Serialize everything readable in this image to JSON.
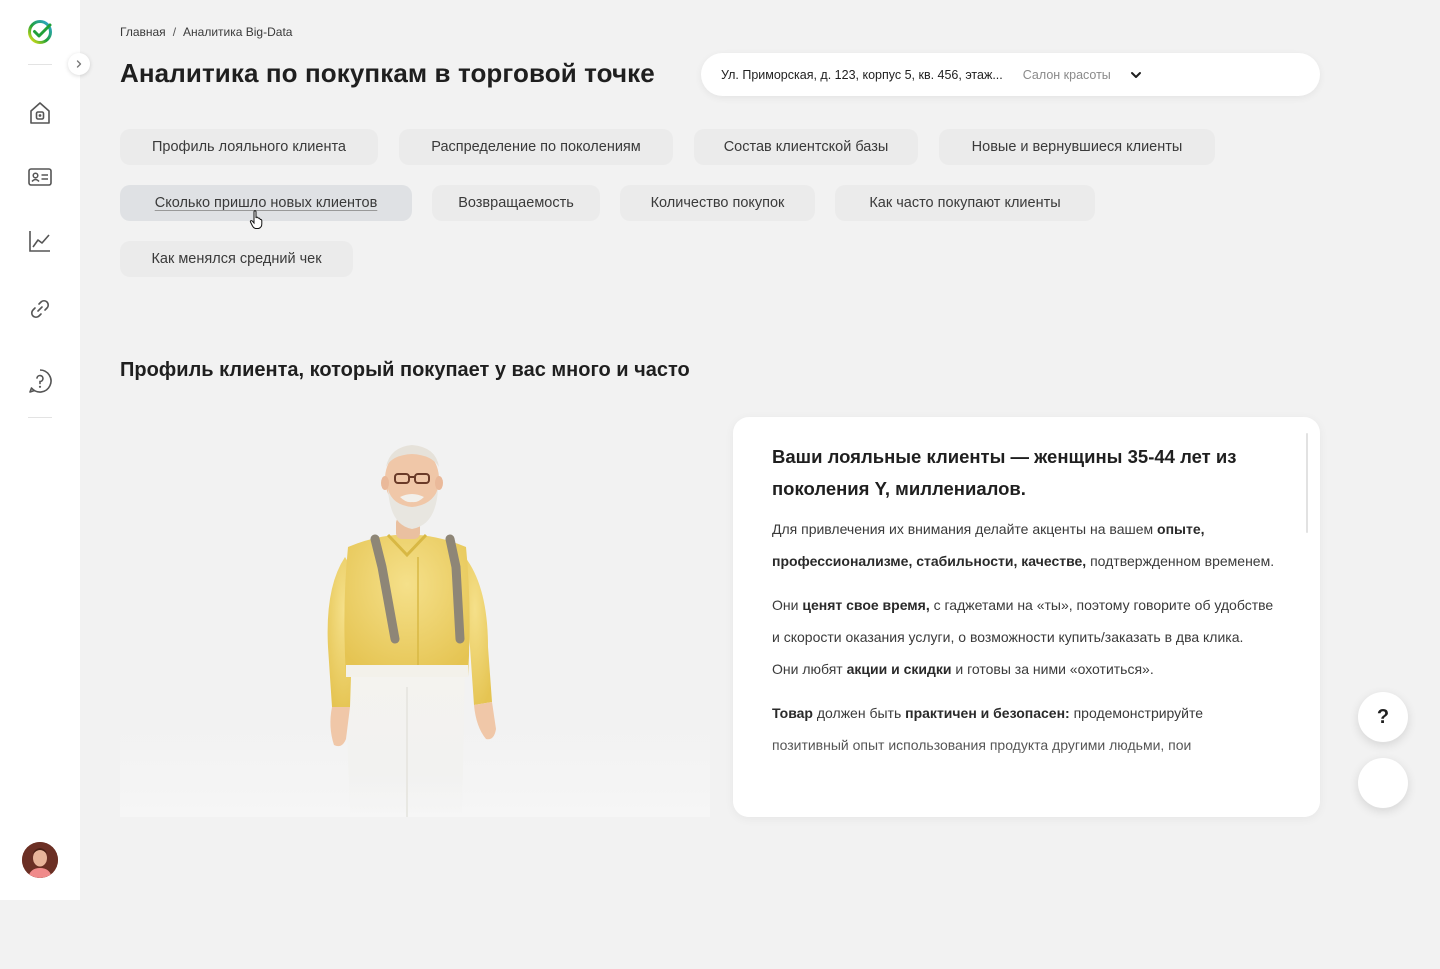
{
  "breadcrumb": {
    "home": "Главная",
    "separator": "/",
    "current": "Аналитика Big-Data"
  },
  "page": {
    "title": "Аналитика по покупкам в торговой точке"
  },
  "location_select": {
    "address": "Ул. Приморская, д. 123, корпус 5, кв. 456, этаж...",
    "category": "Салон красоты"
  },
  "tabs": [
    "Профиль лояльного клиента",
    "Распределение по поколениям",
    "Состав клиентской базы",
    "Новые и вернувшиеся клиенты",
    "Сколько пришло новых клиентов",
    "Возвращаемость",
    "Количество покупок",
    "Как часто покупают клиенты",
    "Как менялся средний чек"
  ],
  "section": {
    "title": "Профиль клиента, который покупает у вас много и часто"
  },
  "card": {
    "heading": "Ваши лояльные клиенты — женщины 35-44 лет из поколения Y, миллениалов.",
    "p1": {
      "a": "Для привлечения их внимания делайте акценты на вашем ",
      "b": "опыте, профессионализме, стабильности, качестве,",
      "c": " подтвержденном временем."
    },
    "p2": {
      "a": "Они ",
      "b": "ценят свое время,",
      "c": " с гаджетами на «ты», поэтому говорите об удобстве и скорости оказания услуги, о возможности купить/заказать в два клика."
    },
    "p3": {
      "a": "Они любят ",
      "b": "акции и скидки",
      "c": " и готовы за ними «охотиться»."
    },
    "p4": {
      "a": "Товар",
      "b": " должен быть ",
      "c": "практичен и безопасен:",
      "d": " продемонстрируйте позитивный опыт использования продукта другими людьми, пои"
    }
  },
  "help_button": {
    "label": "?"
  },
  "icons": {
    "sidebar": [
      "logo-icon",
      "home-icon",
      "id-card-icon",
      "chart-icon",
      "link-icon",
      "help-icon"
    ],
    "collapse": "chevron-right-icon",
    "select": "chevron-down-icon"
  },
  "colors": {
    "background": "#f2f2f2",
    "surface": "#ffffff",
    "tab": "#ebebeb",
    "tab_hover": "#dfe1e4",
    "brand_green": "#21a038"
  }
}
